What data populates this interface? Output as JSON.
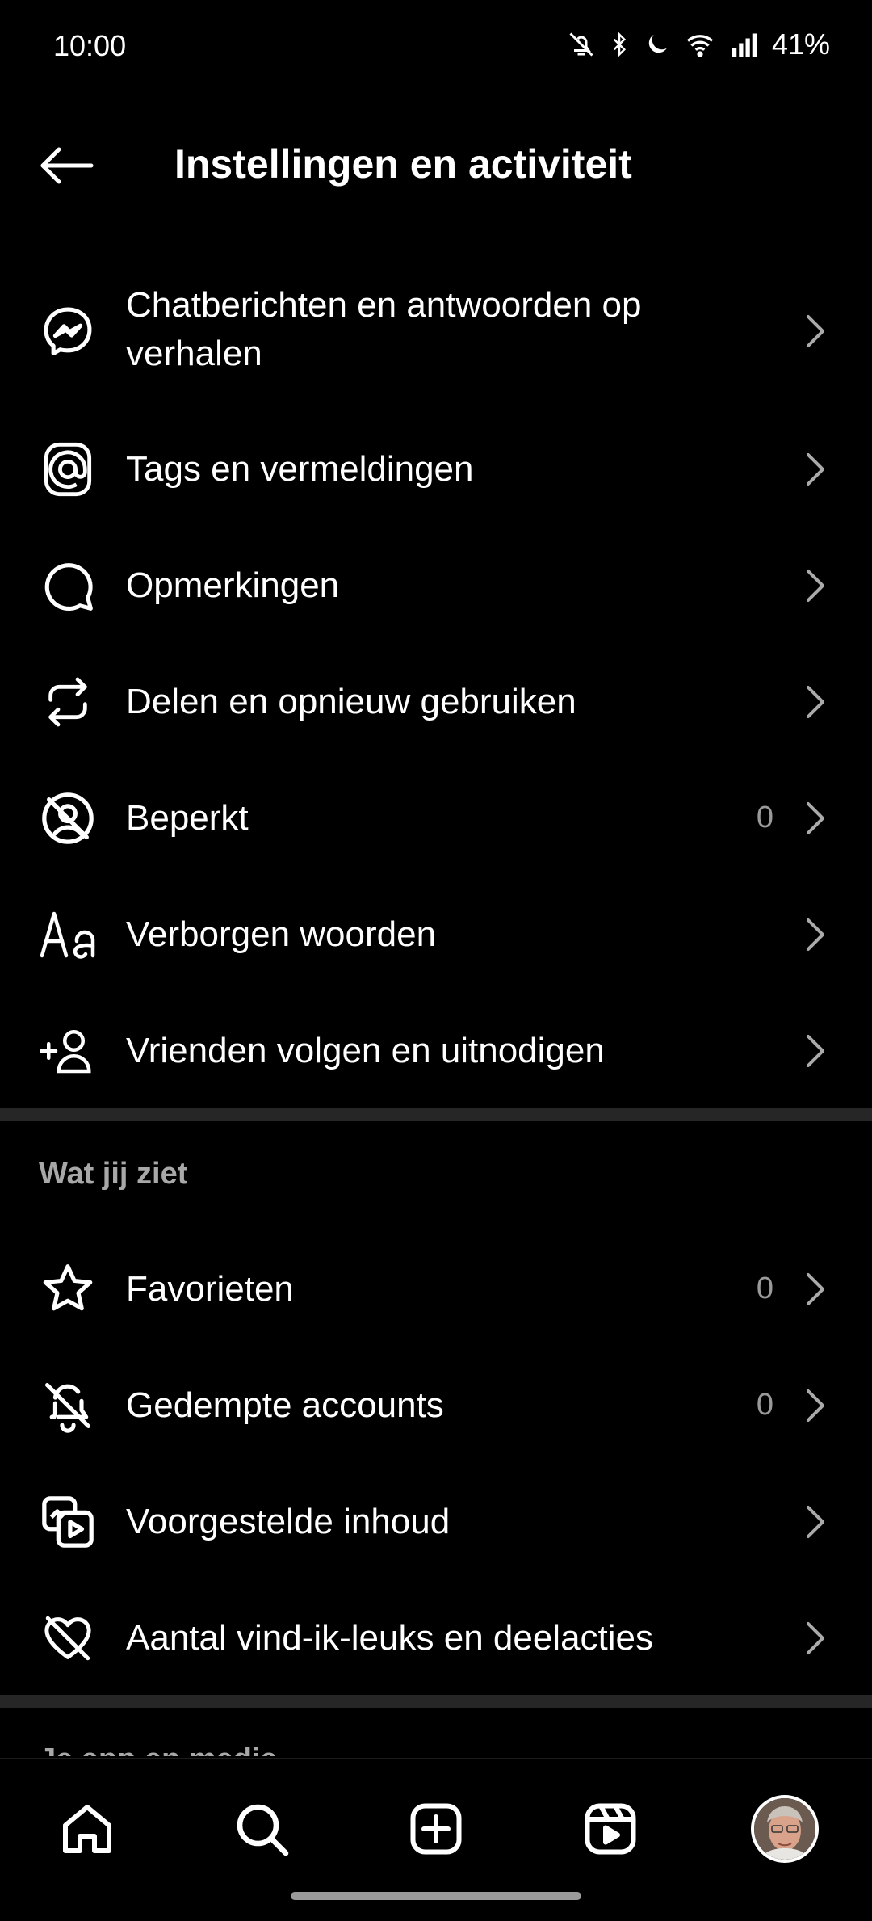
{
  "status": {
    "time": "10:00",
    "battery": "41%",
    "icons": [
      "bell-off-icon",
      "bluetooth-icon",
      "moon-icon",
      "wifi-icon",
      "signal-icon"
    ]
  },
  "header": {
    "title": "Instellingen en activiteit",
    "back_icon": "arrow-left-icon"
  },
  "interactions": [
    {
      "label": "Chatberichten en antwoorden op verhalen",
      "icon": "messenger-icon",
      "count": ""
    },
    {
      "label": "Tags en vermeldingen",
      "icon": "at-sign-icon",
      "count": ""
    },
    {
      "label": "Opmerkingen",
      "icon": "comment-icon",
      "count": ""
    },
    {
      "label": "Delen en opnieuw gebruiken",
      "icon": "repost-icon",
      "count": ""
    },
    {
      "label": "Beperkt",
      "icon": "restricted-icon",
      "count": "0"
    },
    {
      "label": "Verborgen woorden",
      "icon": "text-aa-icon",
      "count": ""
    },
    {
      "label": "Vrienden volgen en uitnodigen",
      "icon": "add-person-icon",
      "count": ""
    }
  ],
  "what_you_see": {
    "title": "Wat jij ziet",
    "items": [
      {
        "label": "Favorieten",
        "icon": "star-icon",
        "count": "0"
      },
      {
        "label": "Gedempte accounts",
        "icon": "bell-muted-icon",
        "count": "0"
      },
      {
        "label": "Voorgestelde inhoud",
        "icon": "suggested-content-icon",
        "count": ""
      },
      {
        "label": "Aantal vind-ik-leuks en deelacties",
        "icon": "heart-off-icon",
        "count": ""
      }
    ]
  },
  "next_section_title": "Je app en media",
  "bottom_nav": [
    "home-icon",
    "search-icon",
    "create-icon",
    "reels-icon",
    "profile-avatar"
  ],
  "colors": {
    "background": "#000000",
    "text": "#ffffff",
    "secondary": "#a8a8a8",
    "divider": "#262626"
  }
}
